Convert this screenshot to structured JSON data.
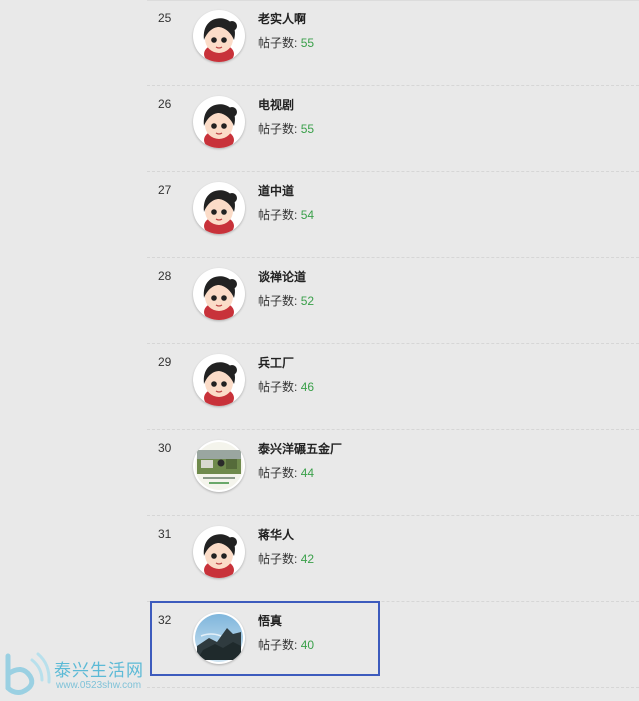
{
  "members": [
    {
      "rank": "25",
      "name": "老实人啊",
      "posts_label": "帖子数:",
      "posts": "55",
      "avatar": "default-cartoon-avatar"
    },
    {
      "rank": "26",
      "name": "电视剧",
      "posts_label": "帖子数:",
      "posts": "55",
      "avatar": "default-cartoon-avatar"
    },
    {
      "rank": "27",
      "name": "道中道",
      "posts_label": "帖子数:",
      "posts": "54",
      "avatar": "default-cartoon-avatar"
    },
    {
      "rank": "28",
      "name": "谈禅论道",
      "posts_label": "帖子数:",
      "posts": "52",
      "avatar": "default-cartoon-avatar"
    },
    {
      "rank": "29",
      "name": "兵工厂",
      "posts_label": "帖子数:",
      "posts": "46",
      "avatar": "default-cartoon-avatar"
    },
    {
      "rank": "30",
      "name": "泰兴洋碾五金厂",
      "posts_label": "帖子数:",
      "posts": "44",
      "avatar": "photo-factory-avatar"
    },
    {
      "rank": "31",
      "name": "蒋华人",
      "posts_label": "帖子数:",
      "posts": "42",
      "avatar": "default-cartoon-avatar"
    },
    {
      "rank": "32",
      "name": "悟真",
      "posts_label": "帖子数:",
      "posts": "40",
      "avatar": "photo-mountain-avatar"
    }
  ],
  "watermark": {
    "title": "泰兴生活网",
    "url": "www.0523shw.com"
  },
  "colors": {
    "accent": "#3aa04a",
    "highlight_border": "#3d5bbd",
    "watermark": "#5cbad6"
  }
}
